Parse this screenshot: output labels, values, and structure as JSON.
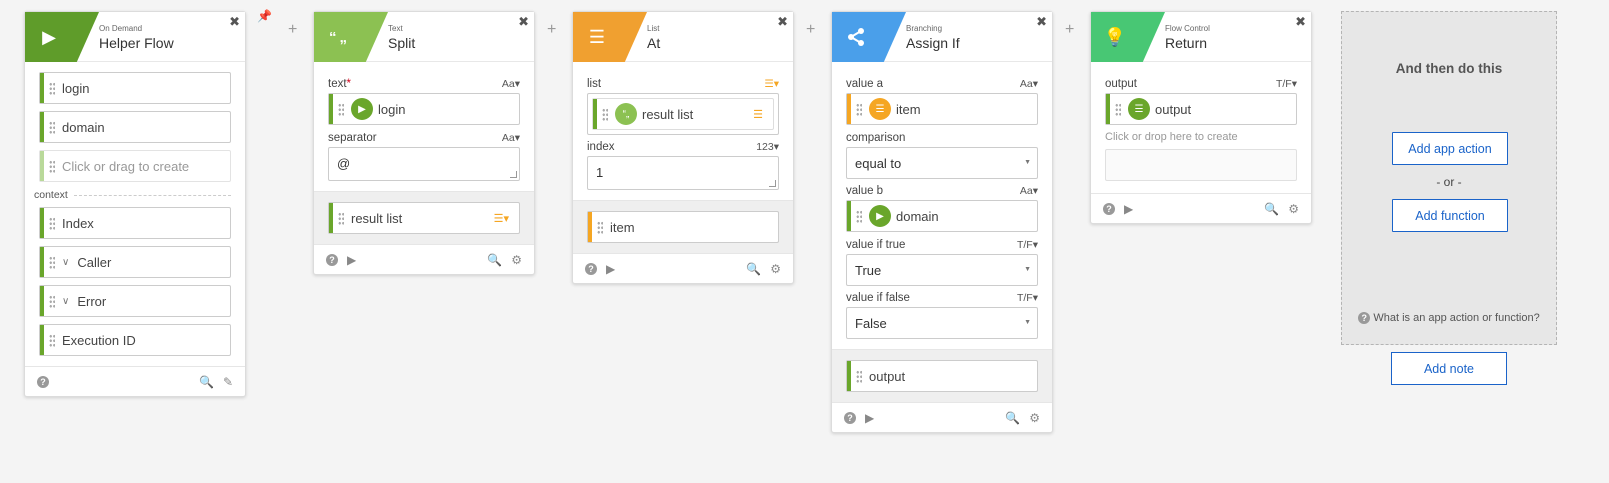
{
  "cards": {
    "helper": {
      "type": "On Demand",
      "title": "Helper Flow",
      "color": "#5f9c2a",
      "inputs": [
        "login",
        "domain"
      ],
      "placeholder": "Click or drag to create",
      "context_label": "context",
      "context_items": [
        "Index",
        "Caller",
        "Error",
        "Execution ID"
      ]
    },
    "split": {
      "type": "Text",
      "title": "Split",
      "color": "#8cc152",
      "text_label": "text",
      "text_required": "*",
      "text_type": "Aa",
      "text_value": "login",
      "separator_label": "separator",
      "separator_type": "Aa",
      "separator_value": "@",
      "output": "result list"
    },
    "at": {
      "type": "List",
      "title": "At",
      "color": "#f0a030",
      "list_label": "list",
      "list_value": "result list",
      "index_label": "index",
      "index_type": "123",
      "index_value": "1",
      "output": "item"
    },
    "assign": {
      "type": "Branching",
      "title": "Assign If",
      "color": "#4a9fea",
      "value_a_label": "value a",
      "value_a_type": "Aa",
      "value_a": "item",
      "comparison_label": "comparison",
      "comparison": "equal to",
      "value_b_label": "value b",
      "value_b_type": "Aa",
      "value_b": "domain",
      "if_true_label": "value if true",
      "if_true_type": "T/F",
      "if_true": "True",
      "if_false_label": "value if false",
      "if_false_type": "T/F",
      "if_false": "False",
      "output": "output"
    },
    "return": {
      "type": "Flow Control",
      "title": "Return",
      "color": "#48c774",
      "output_label": "output",
      "output_type": "T/F",
      "output_value": "output",
      "drop_hint": "Click or drop here to create"
    }
  },
  "then_panel": {
    "title": "And then do this",
    "add_app_action": "Add app action",
    "or": "- or -",
    "add_function": "Add function",
    "help": "What is an app action or function?"
  },
  "add_note": "Add note"
}
